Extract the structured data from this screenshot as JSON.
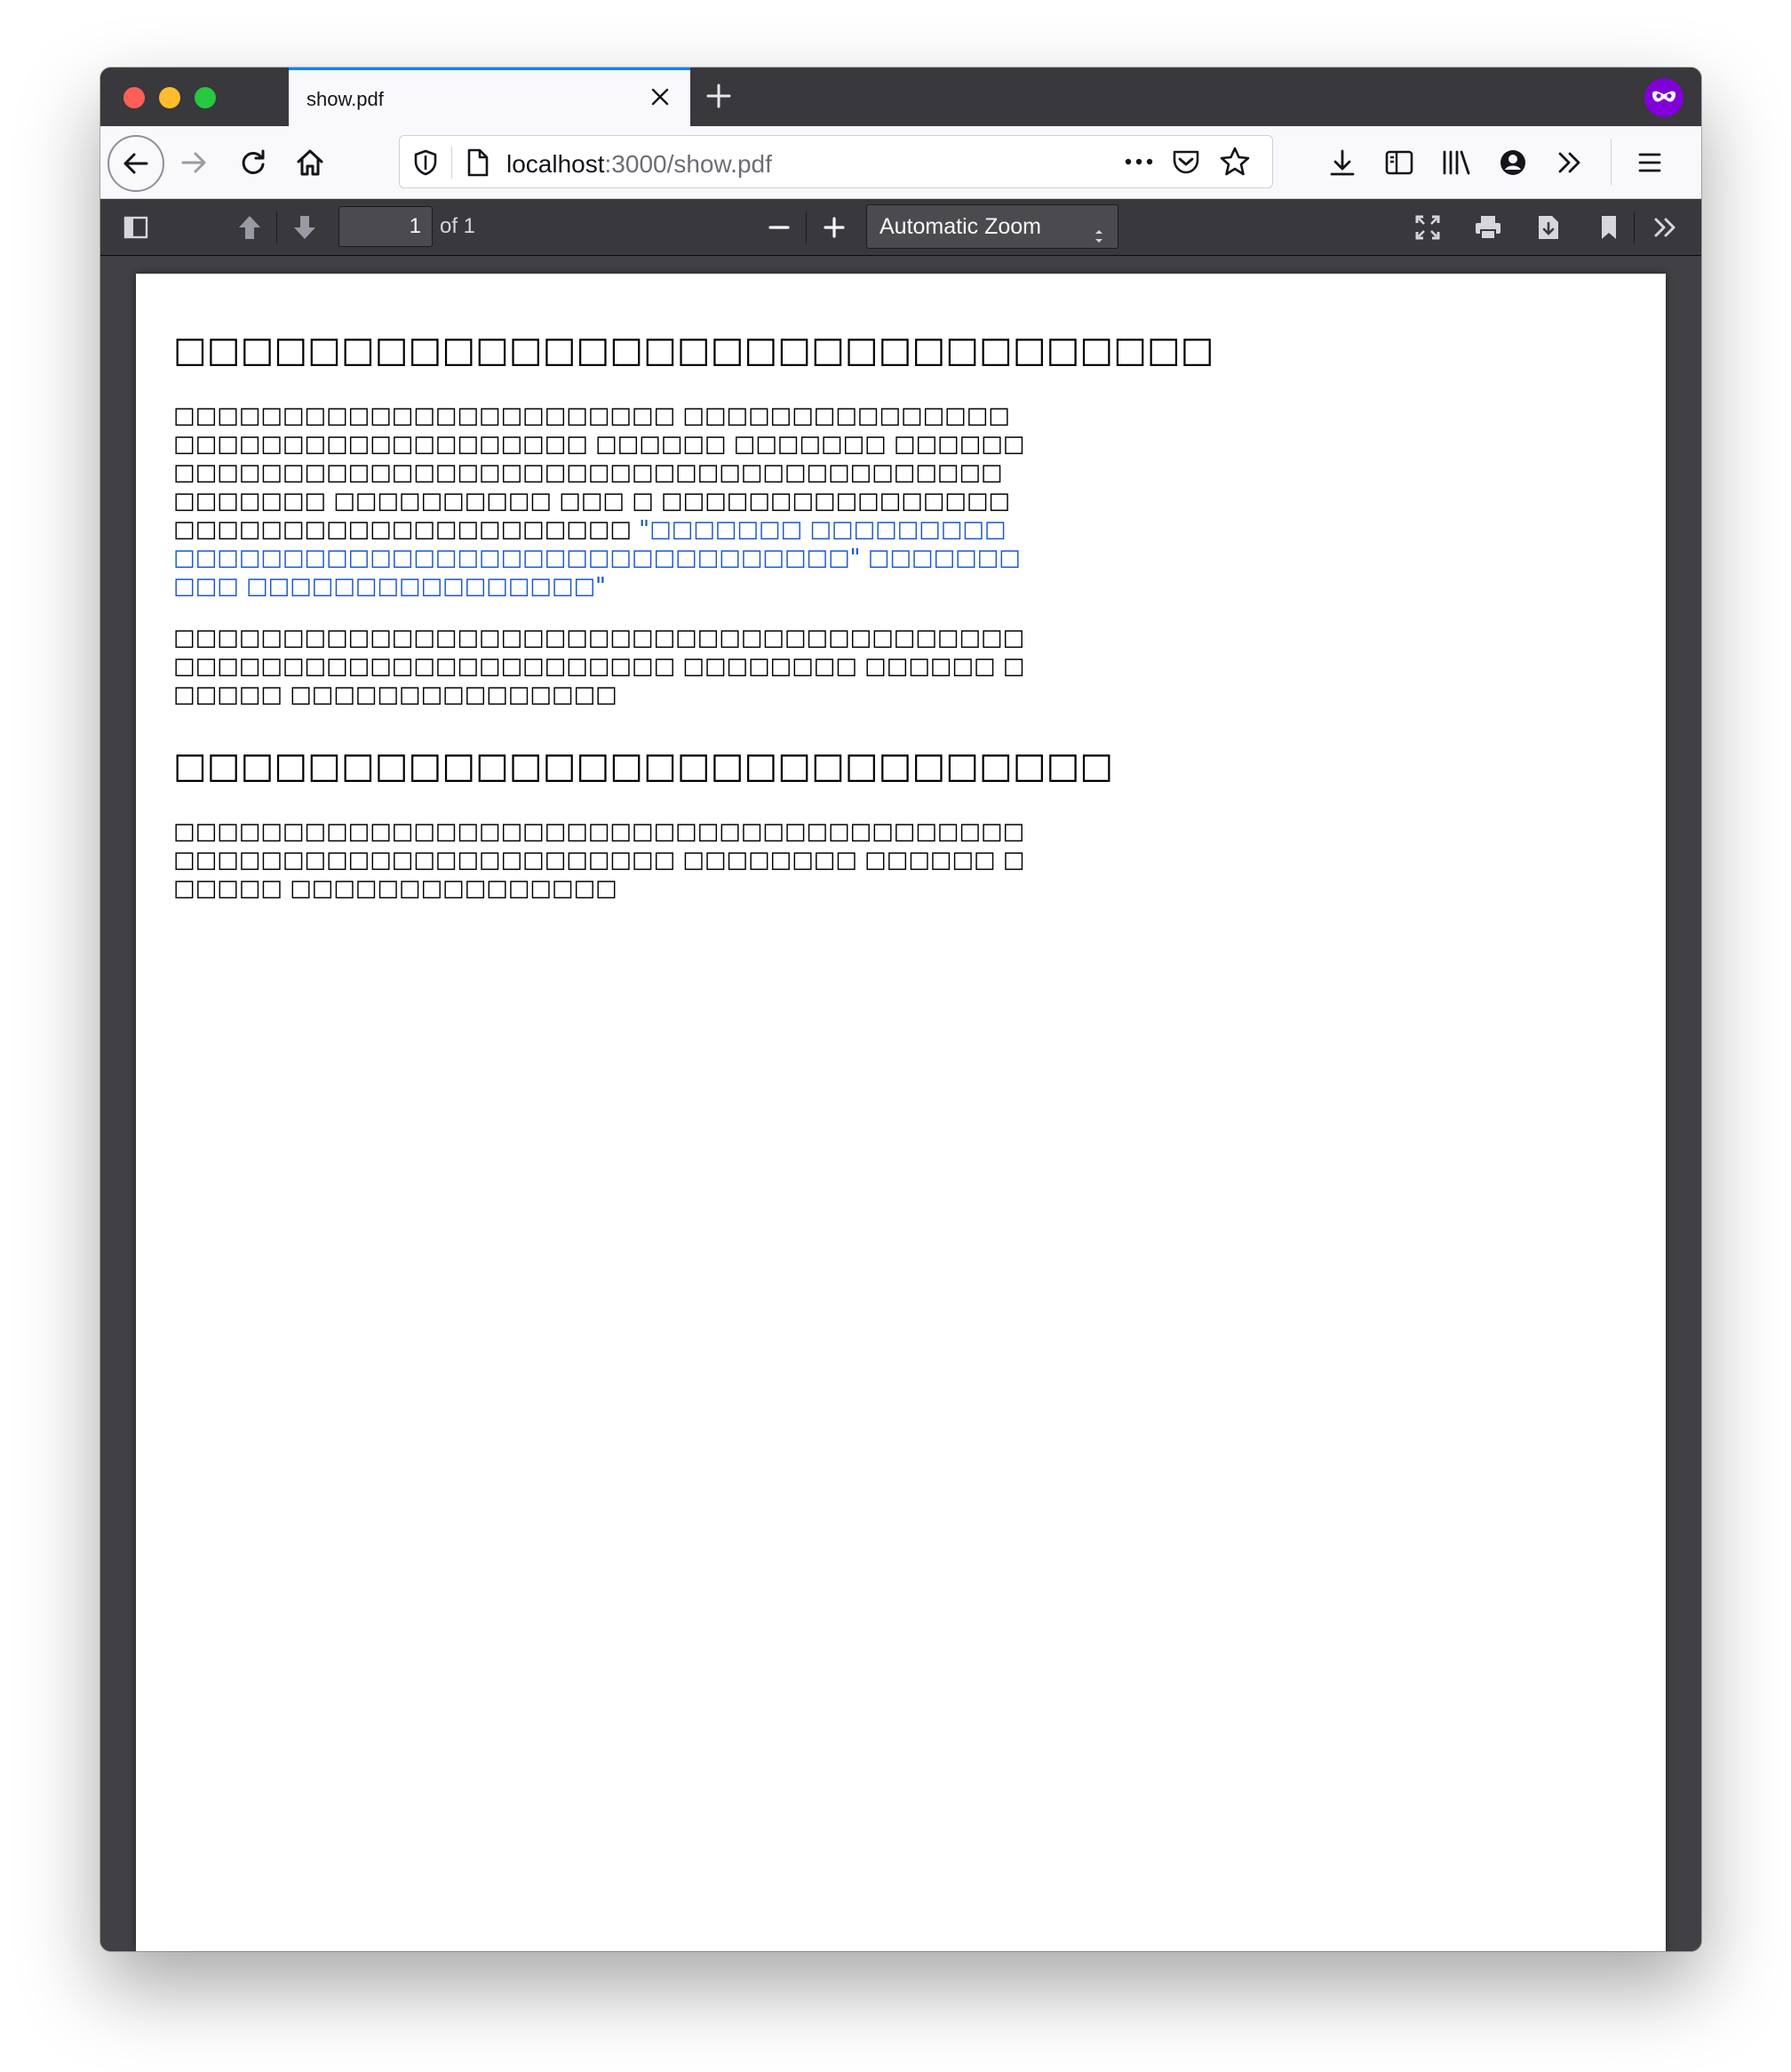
{
  "browser": {
    "tab_title": "show.pdf",
    "url_host": "localhost",
    "url_rest": ":3000/show.pdf"
  },
  "pdf_toolbar": {
    "page_number": "1",
    "page_of": "of 1",
    "zoom_label": "Automatic Zoom"
  },
  "document": {
    "heading_1": "□□□□□□□□□□□□□□□□□□□□□□□□□□□□□□□",
    "paragraph_1_part_1": "□□□□□□□□□□□□□□□□□□□□□□□ □□□□□□□□□□□□□□□□□□□□□□□□□□□□□□□□□□ □□□□□□ □□□□□□□ □□□□□□□□□□□□□□□□□□□□□□□□□□□□□□□□□□□□□□□□□□□□ □□□□□□□ □□□□□□□□□□ □□□ □ □□□□□□□□□□□□□□□□□□□□□□□□□□□□□□□□□□□□□",
    "paragraph_1_quote": "\"□□□□□□□ □□□□□□□□□□□□□□□□□□□□□□□□□□□□□□□□□□□□□□□□\" □□□□□□□□□□ □□□□□□□□□□□□□□□□\"",
    "paragraph_2": "□□□□□□□□□□□□□□□□□□□□□□□□□□□□□□□□□□□□□□□□□□□□□□□□□□□□□□□□□□□□□□ □□□□□□□□ □□□□□□ □□□□□□ □□□□□□□□□□□□□□□",
    "heading_2": "□□□□□□□□□□□□□□□□□□□□□□□□□□□□",
    "paragraph_3": "□□□□□□□□□□□□□□□□□□□□□□□□□□□□□□□□□□□□□□□□□□□□□□□□□□□□□□□□□□□□□□ □□□□□□□□ □□□□□□ □□□□□□ □□□□□□□□□□□□□□□"
  },
  "colors": {
    "traffic_red": "#fe5f57",
    "traffic_yellow": "#febc2e",
    "traffic_green": "#28c840",
    "private_badge": "#8000d7",
    "tab_accent": "#0a84ff",
    "quote_text": "#1a56cc"
  },
  "icons": [
    "back-icon",
    "forward-icon",
    "reload-icon",
    "home-icon",
    "shield-icon",
    "page-icon",
    "more-icon",
    "pocket-icon",
    "star-icon",
    "download-icon",
    "reader-icon",
    "library-icon",
    "account-icon",
    "overflow-icon",
    "menu-icon",
    "sidebar-toggle-icon",
    "previous-page-icon",
    "next-page-icon",
    "zoom-out-icon",
    "zoom-in-icon",
    "presentation-icon",
    "print-icon",
    "save-icon",
    "bookmark-icon",
    "tools-icon"
  ]
}
